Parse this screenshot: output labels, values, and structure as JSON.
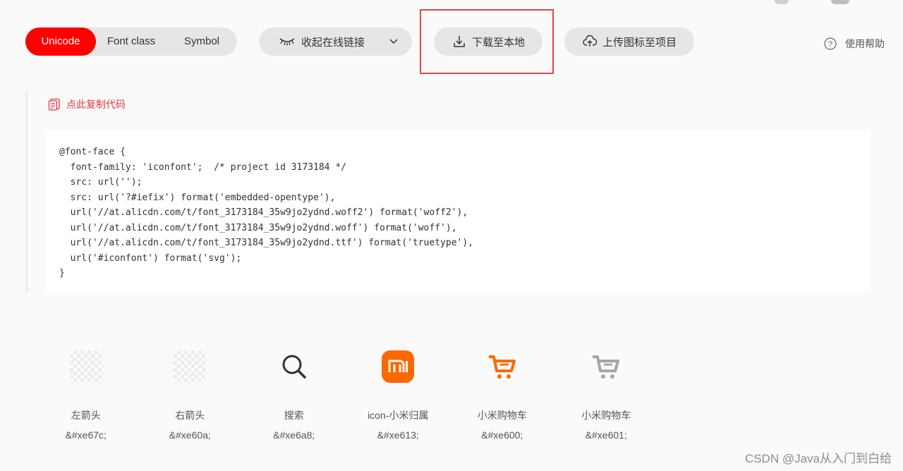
{
  "tabs": [
    {
      "label": "Unicode",
      "active": true
    },
    {
      "label": "Font class",
      "active": false
    },
    {
      "label": "Symbol",
      "active": false
    }
  ],
  "toolbar": {
    "collapse_label": "收起在线链接",
    "download_label": "下载至本地",
    "upload_label": "上传图标至项目",
    "help_label": "使用帮助"
  },
  "copy_code_label": "点此复制代码",
  "code_lines": [
    "@font-face {",
    "  font-family: 'iconfont';  /* project id 3173184 */",
    "  src: url('');",
    "  src: url('?#iefix') format('embedded-opentype'),",
    "  url('//at.alicdn.com/t/font_3173184_35w9jo2ydnd.woff2') format('woff2'),",
    "  url('//at.alicdn.com/t/font_3173184_35w9jo2ydnd.woff') format('woff'),",
    "  url('//at.alicdn.com/t/font_3173184_35w9jo2ydnd.ttf') format('truetype'),",
    "  url('#iconfont') format('svg');",
    "}"
  ],
  "icons": [
    {
      "name": "左箭头",
      "code": "&#xe67c;",
      "icon": "left-arrow-icon"
    },
    {
      "name": "右箭头",
      "code": "&#xe60a;",
      "icon": "right-arrow-icon"
    },
    {
      "name": "搜索",
      "code": "&#xe6a8;",
      "icon": "search-icon"
    },
    {
      "name": "icon-小米归属",
      "code": "&#xe613;",
      "icon": "xiaomi-logo-icon"
    },
    {
      "name": "小米购物车",
      "code": "&#xe600;",
      "icon": "cart-orange-icon"
    },
    {
      "name": "小米购物车",
      "code": "&#xe601;",
      "icon": "cart-gray-icon"
    }
  ],
  "watermark": "CSDN @Java从入门到白给",
  "colors": {
    "accent": "#ff0000",
    "highlight_border": "#e54545",
    "mi_orange": "#ff6700",
    "cart_gray": "#a6a6a6"
  }
}
